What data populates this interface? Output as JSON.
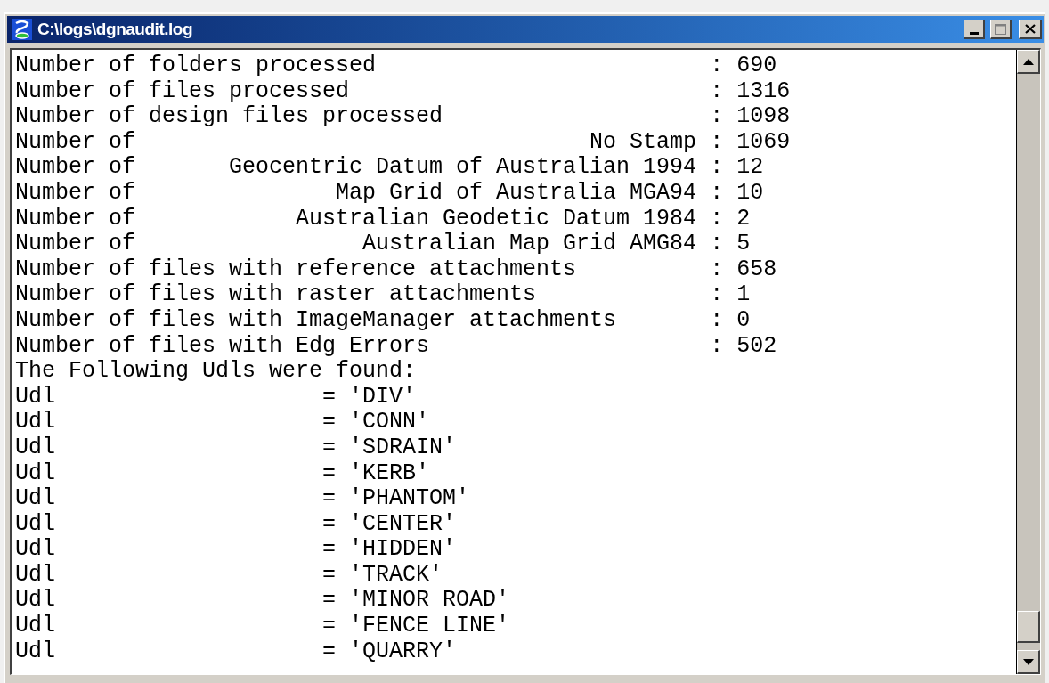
{
  "window": {
    "title": "C:\\logs\\dgnaudit.log"
  },
  "log_lines": [
    "Number of folders processed                         : 690",
    "Number of files processed                           : 1316",
    "Number of design files processed                    : 1098",
    "Number of                                  No Stamp : 1069",
    "Number of       Geocentric Datum of Australian 1994 : 12",
    "Number of               Map Grid of Australia MGA94 : 10",
    "Number of            Australian Geodetic Datum 1984 : 2",
    "Number of                 Australian Map Grid AMG84 : 5",
    "Number of files with reference attachments          : 658",
    "Number of files with raster attachments             : 1",
    "Number of files with ImageManager attachments       : 0",
    "Number of files with Edg Errors                     : 502",
    "The Following Udls were found:",
    "Udl                    = 'DIV'",
    "Udl                    = 'CONN'",
    "Udl                    = 'SDRAIN'",
    "Udl                    = 'KERB'",
    "Udl                    = 'PHANTOM'",
    "Udl                    = 'CENTER'",
    "Udl                    = 'HIDDEN'",
    "Udl                    = 'TRACK'",
    "Udl                    = 'MINOR ROAD'",
    "Udl                    = 'FENCE LINE'",
    "Udl                    = 'QUARRY'"
  ]
}
